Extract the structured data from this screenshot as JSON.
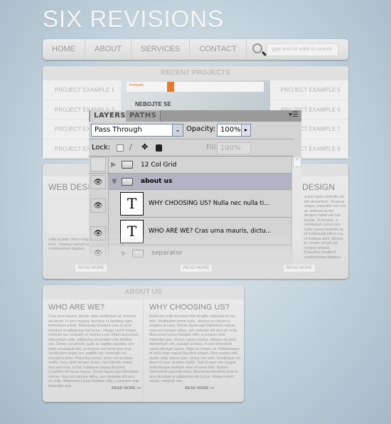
{
  "site": {
    "title": "SIX REVISIONS",
    "nav": [
      "HOME",
      "ABOUT",
      "SERVICES",
      "CONTACT"
    ],
    "search_placeholder": "type and hit enter to search",
    "recent": {
      "heading": "RECENT PROJECTS",
      "left": [
        "PROJECT EXAMPLE 1",
        "PROJECT EXAMPLE 2",
        "PROJECT EXAMPLE 3",
        "PROJECT EXAMPLE 4"
      ],
      "right": [
        "PROJECT EXAMPLE 5",
        "PROJECT EXAMPLE 6",
        "PROJECT EXAMPLE 7",
        "PROJECT EXAMPLE 8"
      ],
      "shot_logo": "Kompakt",
      "shot_headline": "NEBOJTE SE"
    },
    "services": {
      "left_heading": "WEB DESIGN",
      "right_heading": "DESIGN",
      "left_text": "nulla ut dolor. Nunc a ligula. Proin nisl odio, scelerisque nunc. Vivamus laoreet vel. Phasellus hendrerit condimentum dapibus.",
      "right_text": "a quis ligula molestie dui elit elementum. Vivamus neque, imperdiet non ces at, vehicula id nisl. tempus mattis nisl lum lacinia. Ut tempus, a vestibulum cursus per, nulla massa molestie at, id malesuada libero cus, et tristique ante. ultrices in, ornare vel get dui congue tempus. Phasellus hendrerit condimentum dapibus.",
      "read_more": "READ MORE"
    },
    "about": {
      "heading": "ABOUT US",
      "col1_title": "WHO ARE WE?",
      "col1_text": "Cras urna mauris, dictum vitae vestibulum at, rhoncus vel lorem. In arcu magna, faucibus at faucibus eget, fermentum a felis. Maecenas tincidunt urna et arcu tincidunt ut adipiscing nisi luctus. Integer lorem neque, vehicula nec molestie ut, lacinia a est. Etiam accumsan elementum ante, adipiscing venenatis nulla facilisis nec. Donec accumsan, justo ac sagittis egestas, orci enim consequat nisl, ut rhoncus est tortor quis erat. Vestibulum neque leo, sagittis nec venenatis eu, suscipit a dolor. Phasellus luctus, tortor non pretium mollis, nunc dolor tempor lectus, non lobortis metus erat sed urna. In hac habitasse platea dictumst. Curabitur vel lacus massa. Donec ligula eget bibendum rutrum, risus orci tempor tellus, non molestie elit arcu ac nulla. Maecenas luctus tristique nibh, a posuere erat imperdiet quis.",
      "col2_title": "WHY CHOOSING US?",
      "col2_text": "Nulla nec nulla tincidunt felis fringilla vulputate id nec felis. Vestibulum lorem nulla, ultricies eu rutrum a, sodales at nunc. Donec ligula eget bibendum rutrum, risus orci tempor tellus, non molestie elit arcu ac nulla. Maecenas luctus tristique nibh, a posuere erat imperdiet quis. Donec sapien metus, ultricies sit amet elementum sed, suscipit ut tellus. Fusce bibendum varius elit eget auctor. Nulla ac ornare mi. Pellentesque id nulla vitae massa faucibus aliquet. Duis massa velit, mattis vitae rutrum quis, varius non sem. Vestibulum vel libero id nunc pretium mollis. Sed id nunc nec magna pellentesque tristique vitae sit amet felis. Nullam elementum placerat tellus. Maecenas tincidunt urna et arcu tincidunt ut adipiscing nisi luctus. Integer lorem neque, vehicula nec.",
      "read_more": "READ MORE >>"
    }
  },
  "layers_panel": {
    "tabs": [
      "LAYERS",
      "PATHS"
    ],
    "active_tab": "LAYERS",
    "blend_mode": "Pass Through",
    "opacity_label": "Opacity:",
    "opacity": "100%",
    "lock_label": "Lock:",
    "fill_label": "Fill:",
    "fill": "100%",
    "layers": [
      {
        "name": "12 Col Grid",
        "type": "group",
        "visible": false,
        "expanded": false
      },
      {
        "name": "about us",
        "type": "group",
        "visible": true,
        "expanded": true,
        "selected": true
      },
      {
        "name": "WHY CHOOSING US?  Nulla nec nulla ti...",
        "type": "text",
        "visible": true,
        "thumb": "T"
      },
      {
        "name": "WHO ARE WE?  Cras urna mauris, dictu...",
        "type": "text",
        "visible": true,
        "thumb": "T"
      },
      {
        "name": "separator",
        "type": "group",
        "visible": true,
        "expanded": false
      }
    ],
    "selected_color": "#b2b3c3"
  }
}
